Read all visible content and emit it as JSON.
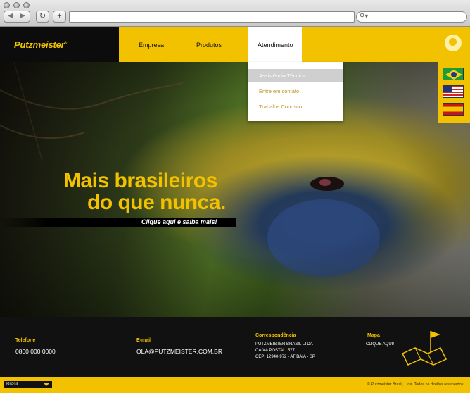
{
  "browser": {
    "back_icon": "◀",
    "forward_icon": "▶",
    "reload_icon": "↻",
    "add_icon": "+",
    "search_icon": "⚲▾"
  },
  "header": {
    "logo": "Putzmeister",
    "nav": [
      "Empresa",
      "Produtos",
      "Atendimento"
    ]
  },
  "dropdown": {
    "items": [
      "Assistência Técnica",
      "Entre em contato",
      "Trabalhe Conosco"
    ]
  },
  "languages": {
    "flags": [
      "brazil-flag",
      "usa-flag",
      "spain-flag"
    ]
  },
  "hero": {
    "line1": "Mais brasileiros",
    "line2": "do que nunca.",
    "cta": "Clique aqui e saiba mais!"
  },
  "footer": {
    "phone_label": "Telefone",
    "phone": "0800 000 0000",
    "email_label": "E-mail",
    "email": "OLA@PUTZMEISTER.COM.BR",
    "mail_label": "Correspondência",
    "mail_line1": "PUTZMEISTER BRASIL LTDA",
    "mail_line2": "CAIXA POSTAL: 577",
    "mail_line3": "CEP: 12940-972 - ATIBAIA - SP",
    "map_label": "Mapa",
    "map_link": "CLIQUE AQUI!"
  },
  "bottom": {
    "country": "Brasil",
    "copyright": "© Putzmeister Brasil, Ltda. Todos os direitos reservados."
  },
  "colors": {
    "brand_yellow": "#f2c200",
    "dark": "#111111"
  }
}
